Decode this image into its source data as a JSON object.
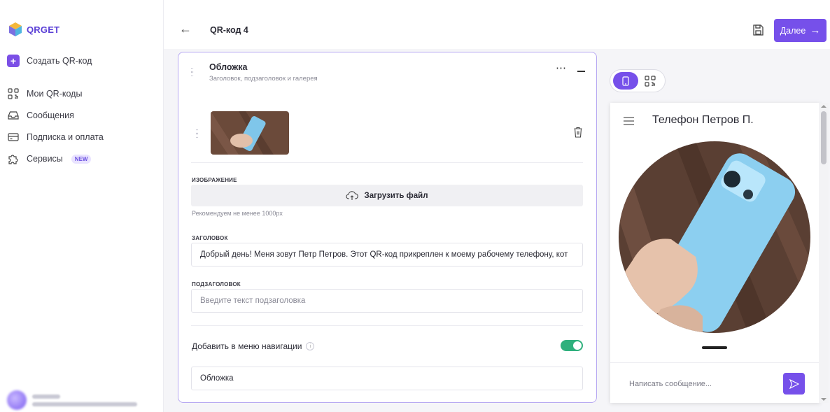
{
  "app": {
    "brand": "QRGET",
    "brand_color": "#7650ea"
  },
  "sidebar": {
    "items": [
      {
        "label": "Создать QR-код",
        "icon": "plus-square-icon"
      },
      {
        "label": "Мои QR-коды",
        "icon": "qr-grid-icon"
      },
      {
        "label": "Сообщения",
        "icon": "inbox-icon"
      },
      {
        "label": "Подписка и оплата",
        "icon": "card-icon"
      },
      {
        "label": "Сервисы",
        "icon": "puzzle-icon",
        "badge": "NEW"
      }
    ]
  },
  "header": {
    "title": "QR-код 4",
    "next_label": "Далее"
  },
  "editor": {
    "section_title": "Обложка",
    "section_subtitle": "Заголовок, подзаголовок и галерея",
    "image_label": "ИЗОБРАЖЕНИЕ",
    "upload_label": "Загрузить файл",
    "upload_hint": "Рекомендуем не менее 1000px",
    "heading_label": "ЗАГОЛОВОК",
    "heading_value": "Добрый день! Меня зовут Петр Петров. Этот QR-код прикреплен к моему рабочему телефону, кот",
    "subheading_label": "ПОДЗАГОЛОВОК",
    "subheading_placeholder": "Введите текст подзаголовка",
    "nav_toggle_label": "Добавить в меню навигации",
    "nav_toggle_on": true,
    "nav_item_value": "Обложка"
  },
  "preview": {
    "title": "Телефон Петров П.",
    "message_placeholder": "Написать сообщение..."
  }
}
